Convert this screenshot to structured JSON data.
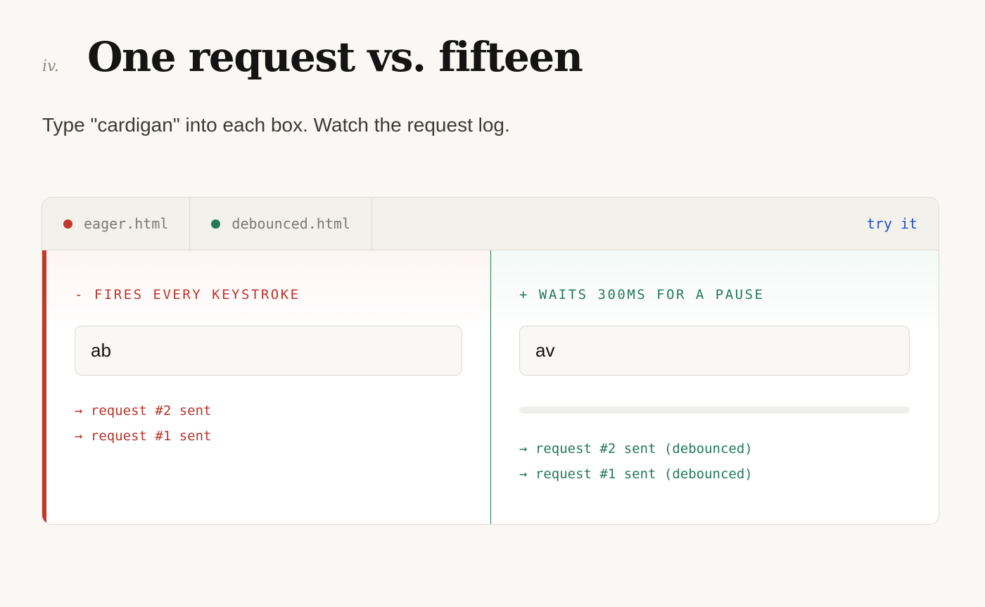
{
  "header": {
    "section_number": "iv.",
    "title": "One request vs. fifteen",
    "subtitle": "Type \"cardigan\" into each box. Watch the request log."
  },
  "tabs": [
    {
      "label": "eager.html",
      "dot_color": "#c0392b"
    },
    {
      "label": "debounced.html",
      "dot_color": "#237a57"
    }
  ],
  "try_it_label": "try it",
  "eager": {
    "heading": "- FIRES EVERY KEYSTROKE",
    "input_value": "ab",
    "log": [
      "→ request #2 sent",
      "→ request #1 sent"
    ],
    "accent": "#c0392b"
  },
  "debounced": {
    "heading": "+ WAITS 300MS FOR A PAUSE",
    "input_value": "av",
    "progress": 0,
    "log": [
      "→ request #2 sent (debounced)",
      "→ request #1 sent (debounced)"
    ],
    "accent": "#237a57"
  }
}
